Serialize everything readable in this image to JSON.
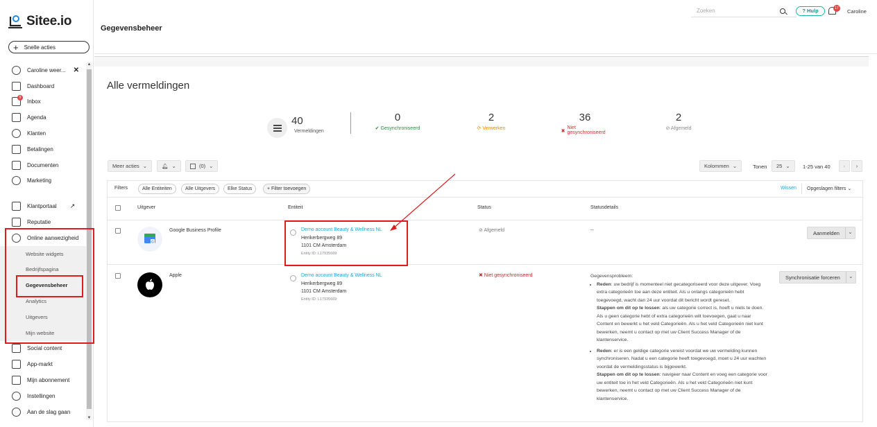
{
  "brand": {
    "name": "Sitee.io"
  },
  "quick_actions": {
    "label": "Snelle acties"
  },
  "sidebar": {
    "items": [
      {
        "label": "Caroline weer...",
        "icon": "users-icon"
      },
      {
        "label": "Dashboard",
        "icon": "dashboard-icon"
      },
      {
        "label": "Inbox",
        "icon": "inbox-icon",
        "badge": "9"
      },
      {
        "label": "Agenda",
        "icon": "calendar-icon"
      },
      {
        "label": "Klanten",
        "icon": "customers-icon"
      },
      {
        "label": "Betalingen",
        "icon": "payments-icon"
      },
      {
        "label": "Documenten",
        "icon": "documents-icon"
      },
      {
        "label": "Marketing",
        "icon": "marketing-icon"
      },
      {
        "label": "Klantportaal",
        "icon": "portal-icon"
      },
      {
        "label": "Reputatie",
        "icon": "reputation-icon"
      },
      {
        "label": "Online aanwezigheid",
        "icon": "globe-icon"
      }
    ],
    "sub_items": [
      {
        "label": "Website widgets"
      },
      {
        "label": "Bedrijfspagina"
      },
      {
        "label": "Gegevensbeheer"
      },
      {
        "label": "Analytics"
      },
      {
        "label": "Uitgevers"
      },
      {
        "label": "Mijn website"
      }
    ],
    "bottom_items": [
      {
        "label": "Social content",
        "icon": "social-icon"
      },
      {
        "label": "App-markt",
        "icon": "store-icon"
      },
      {
        "label": "Mijn abonnement",
        "icon": "subscription-icon"
      },
      {
        "label": "Instellingen",
        "icon": "settings-icon"
      },
      {
        "label": "Aan de slag gaan",
        "icon": "rocket-icon"
      }
    ]
  },
  "header": {
    "title": "Gegevensbeheer",
    "search_placeholder": "Zoeken",
    "help_label": "Hulp",
    "notifications": "17",
    "user": "Caroline"
  },
  "main": {
    "title": "Alle vermeldingen",
    "stats": [
      {
        "value": "40",
        "label": "Vermeldingen"
      },
      {
        "value": "0",
        "label": "Gesynchroniseerd",
        "color": "#2e8b3e"
      },
      {
        "value": "2",
        "label": "Verwerken",
        "color": "#e8890c"
      },
      {
        "value": "36",
        "label": "Niet gesynchroniseerd",
        "color": "#d32f2f"
      },
      {
        "value": "2",
        "label": "Afgemeld",
        "color": "#888888"
      }
    ],
    "toolbar": {
      "more_actions": "Meer acties",
      "selected_count": "(0)",
      "columns": "Kolommen",
      "show_label": "Tonen",
      "page_size": "25",
      "range": "1-25 van 40"
    },
    "filters": {
      "label": "Filters",
      "chips": [
        "Alle Entiteiten",
        "Alle Uitgevers",
        "Elke Status"
      ],
      "add_filter": "+ Filter toevoegen",
      "clear": "Wissen",
      "saved": "Opgeslagen filters"
    },
    "table": {
      "columns": [
        "Uitgever",
        "Entiteit",
        "Status",
        "Statusdetails"
      ],
      "rows": [
        {
          "publisher": "Google Business Profile",
          "entity_name": "Demo account Beauty & Wellness NL",
          "address1": "Herikerbergweg 89",
          "address2": "1101 CM Amsterdam",
          "entity_id": "Entity ID: L17935669",
          "status": "Afgemeld",
          "details": "--",
          "action": "Aanmelden"
        },
        {
          "publisher": "Apple",
          "entity_name": "Demo account Beauty & Wellness NL",
          "address1": "Herikerbergweg 89",
          "address2": "1101 CM Amsterdam",
          "entity_id": "Entity ID: L17935669",
          "status": "Niet gesynchroniseerd",
          "details_title": "Gegevensprobleem:",
          "reason1_label": "Reden",
          "reason1": ": uw bedrijf is momenteel niet gecategoriseerd voor deze uitgever. Voeg extra categorieën toe aan deze entiteit. Als u onlangs categorieën hebt toegevoegd, wacht dan 24 uur voordat dit bericht wordt gereset.",
          "fix1_label": "Stappen om dit op te lossen",
          "fix1": ": als uw categorie correct is, hoeft u niets te doen. Als u geen categorie hebt of extra categorieën wilt toevoegen, gaat u naar Content en bewerkt u het veld Categorieën. Als u het veld Categorieën niet kunt bewerken, neemt u contact op met uw Client Success Manager of de klantenservice.",
          "reason2_label": "Reden",
          "reason2": ": er is een geldige categorie vereist voordat we uw vermelding kunnen synchroniseren. Nadat u een categorie heeft toegevoegd, moet u 24 uur wachten voordat de vermeldingsstatus is bijgewerkt.",
          "fix2_label": "Stappen om dit op te lossen",
          "fix2": ": navigeer naar Content en voeg een categorie voor uw entiteit toe in het veld Categorieën. Als u het veld Categorieën niet kunt bewerken, neemt u contact op met uw Client Success Manager of de klantenservice.",
          "action": "Synchronisatie forceren"
        }
      ]
    }
  }
}
